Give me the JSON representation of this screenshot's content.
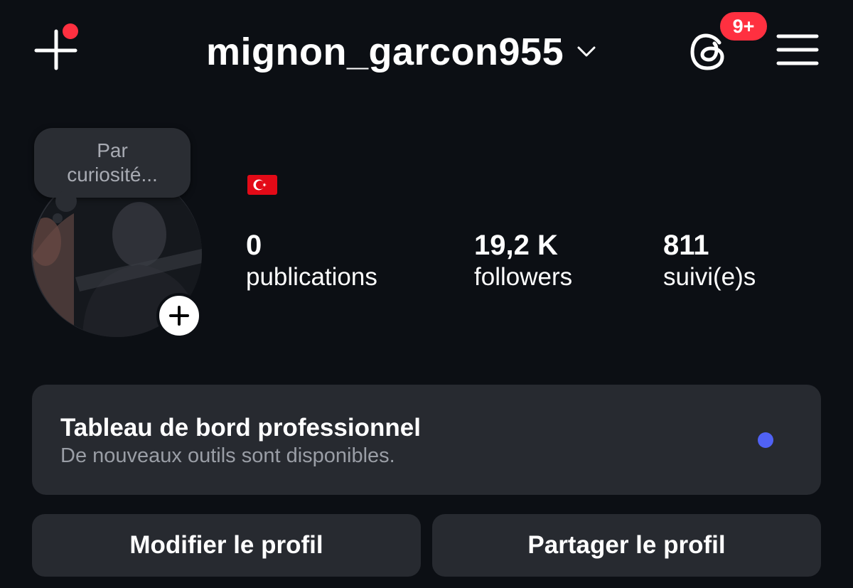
{
  "header": {
    "username": "mignon_garcon955",
    "threads_badge": "9+",
    "icons": {
      "create": "plus-icon",
      "username_dropdown": "chevron-down-icon",
      "threads": "threads-icon",
      "menu": "hamburger-menu-icon"
    },
    "colors": {
      "notification": "#ff3040"
    }
  },
  "profile": {
    "note": {
      "line1": "Par",
      "line2": "curiosité..."
    },
    "bio_flag": "turkey-flag",
    "stats": [
      {
        "value": "0",
        "label": "publications"
      },
      {
        "value": "19,2 K",
        "label": "followers"
      },
      {
        "value": "811",
        "label": "suivi(e)s"
      }
    ],
    "add_story_icon": "plus-icon"
  },
  "dashboard": {
    "title": "Tableau de bord professionnel",
    "subtitle": "De nouveaux outils sont disponibles.",
    "indicator_color": "#5062f5"
  },
  "actions": {
    "edit_profile": "Modifier le profil",
    "share_profile": "Partager le profil"
  },
  "theme": {
    "background": "#0c0f14",
    "card": "#272a30",
    "text": "#ffffff",
    "muted_text": "#9a9ea6"
  }
}
